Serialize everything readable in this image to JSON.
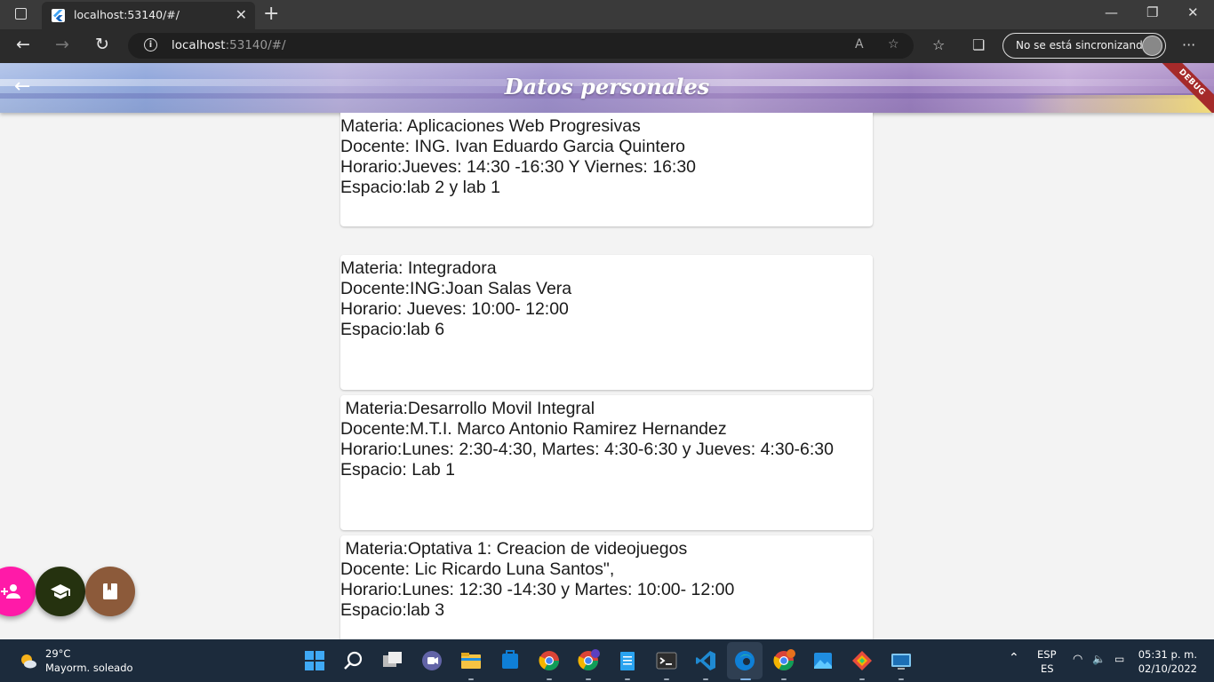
{
  "browser": {
    "tab_title": "localhost:53140/#/",
    "url_host": "localhost",
    "url_path": ":53140/#/",
    "sync_label": "No se está sincronizando"
  },
  "appbar": {
    "title": "Datos personales",
    "debug_banner": "DEBUG"
  },
  "cards": [
    {
      "lines": [
        "Materia: Aplicaciones Web Progresivas",
        "Docente: ING. Ivan Eduardo Garcia Quintero",
        "Horario:Jueves: 14:30 -16:30 Y Viernes: 16:30",
        "Espacio:lab 2 y lab 1"
      ]
    },
    {
      "lines": [
        "Materia: Integradora",
        "Docente:ING:Joan Salas Vera",
        "Horario: Jueves: 10:00- 12:00",
        "Espacio:lab 6"
      ]
    },
    {
      "lines": [
        " Materia:Desarrollo Movil Integral",
        "Docente:M.T.I. Marco Antonio Ramirez Hernandez",
        "Horario:Lunes: 2:30-4:30, Martes: 4:30-6:30 y Jueves: 4:30-6:30",
        "Espacio: Lab 1"
      ]
    },
    {
      "lines": [
        " Materia:Optativa 1: Creacion de videojuegos",
        "Docente: Lic Ricardo Luna Santos\",",
        "Horario:Lunes: 12:30 -14:30 y Martes: 10:00- 12:00",
        "Espacio:lab 3"
      ]
    }
  ],
  "fabs": [
    {
      "icon": "person-add-icon",
      "color": "#ff1aa8"
    },
    {
      "icon": "school-icon",
      "color": "#25320f"
    },
    {
      "icon": "book-icon",
      "color": "#8c5a3a"
    }
  ],
  "taskbar": {
    "temperature": "29°C",
    "condition": "Mayorm. soleado",
    "lang_top": "ESP",
    "lang_bottom": "ES",
    "time": "05:31 p. m.",
    "date": "02/10/2022"
  }
}
